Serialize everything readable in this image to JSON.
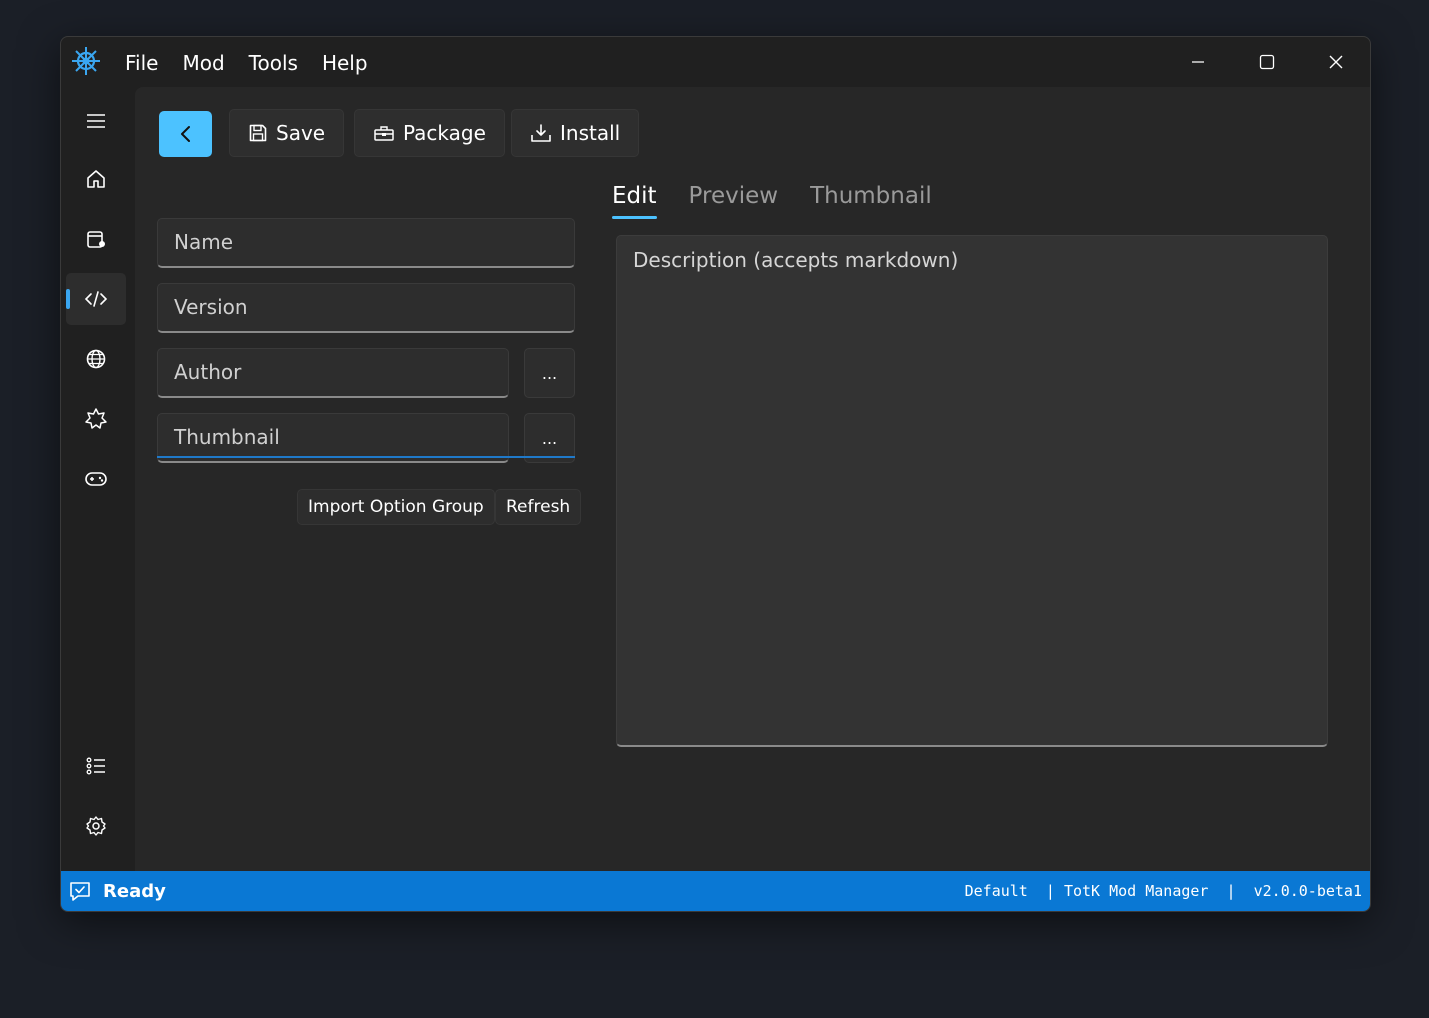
{
  "menu": {
    "items": [
      "File",
      "Mod",
      "Tools",
      "Help"
    ]
  },
  "toolbar": {
    "save_label": "Save",
    "package_label": "Package",
    "install_label": "Install"
  },
  "form": {
    "name_placeholder": "Name",
    "version_placeholder": "Version",
    "author_placeholder": "Author",
    "thumbnail_placeholder": "Thumbnail",
    "browse_label": "...",
    "import_option_group_label": "Import Option Group",
    "refresh_label": "Refresh"
  },
  "tabs": [
    "Edit",
    "Preview",
    "Thumbnail"
  ],
  "description_placeholder": "Description (accepts markdown)",
  "statusbar": {
    "status": "Ready",
    "profile": "Default",
    "sep1": "  | ",
    "app_name": "TotK Mod Manager",
    "sep2": "  |  ",
    "version": "v2.0.0-beta1"
  },
  "colors": {
    "accent": "#4cc2ff",
    "statusbar": "#0a78d4",
    "divider": "#1f79c9"
  }
}
